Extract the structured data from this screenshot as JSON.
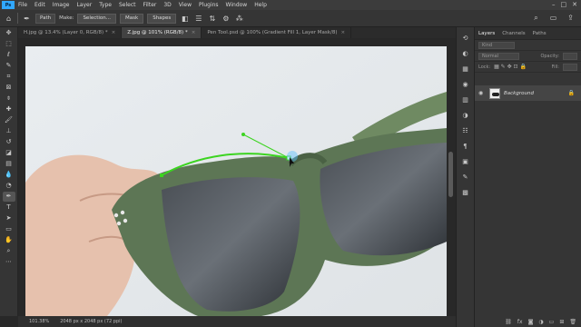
{
  "menubar": {
    "logo": "Ps",
    "items": [
      "File",
      "Edit",
      "Image",
      "Layer",
      "Type",
      "Select",
      "Filter",
      "3D",
      "View",
      "Plugins",
      "Window",
      "Help"
    ]
  },
  "options": {
    "tool_mode": "Path",
    "make_label": "Make:",
    "selection_button": "Selection...",
    "mask_button": "Mask",
    "shapes_button": "Shapes"
  },
  "tabs": [
    {
      "label": "H.jpg @ 13.4% (Layer 0, RGB/8) *"
    },
    {
      "label": "Z.jpg @ 101% (RGB/8) *"
    },
    {
      "label": "Pen Tool.psd @ 100% (Gradient Fill 1, Layer Mask/8)"
    }
  ],
  "status": {
    "zoom": "101.38%",
    "doc_info": "2048 px x 2048 px (72 ppi)"
  },
  "layers_panel": {
    "tabs": [
      "Layers",
      "Channels",
      "Paths"
    ],
    "search_placeholder": "Kind",
    "blend_mode": "Normal",
    "opacity_label": "Opacity:",
    "lock_label": "Lock:",
    "fill_label": "Fill:",
    "layer_name": "Background"
  },
  "colors": {
    "foreground": "#56c93a",
    "background": "#2f7f1f",
    "path_stroke": "#3cd421",
    "accent": "#31a8ff"
  }
}
